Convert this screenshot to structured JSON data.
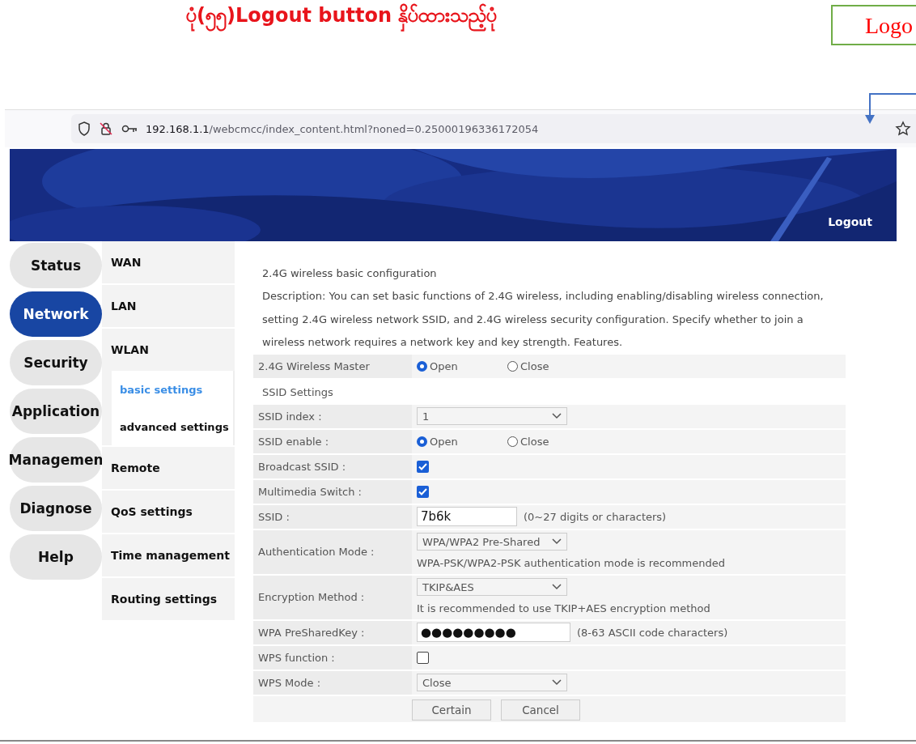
{
  "heading": "ပုံ(၅၅)Logout button နှိပ်ထားသည့်ပုံ",
  "callout": {
    "text": "Logo"
  },
  "browser": {
    "url_host": "192.168.1.1",
    "url_path": "/webcmcc/index_content.html?noned=0.25000196336172054"
  },
  "banner": {
    "logout": "Logout"
  },
  "main_menu": [
    {
      "label": "Status",
      "selected": false
    },
    {
      "label": "Network",
      "selected": true
    },
    {
      "label": "Security",
      "selected": false
    },
    {
      "label": "Application",
      "selected": false
    },
    {
      "label": "Managemen",
      "selected": false
    },
    {
      "label": "Diagnose",
      "selected": false
    },
    {
      "label": "Help",
      "selected": false
    }
  ],
  "sub_menu": [
    {
      "label": "WAN",
      "selected": false
    },
    {
      "label": "LAN",
      "selected": false
    },
    {
      "label": "WLAN",
      "selected": false,
      "children": [
        {
          "label": "basic settings",
          "selected": true
        },
        {
          "label": "advanced settings",
          "selected": false
        }
      ]
    },
    {
      "label": "Remote",
      "selected": false
    },
    {
      "label": "QoS settings",
      "selected": false
    },
    {
      "label": "Time management",
      "selected": false
    },
    {
      "label": "Routing settings",
      "selected": false
    }
  ],
  "content": {
    "title": "2.4G wireless basic configuration",
    "description": "Description: You can set basic functions of 2.4G wireless, including enabling/disabling wireless connection, setting 2.4G wireless network SSID, and 2.4G wireless security configuration. Specify whether to join a wireless network requires a network key and key strength. Features.",
    "rows": [
      {
        "kind": "radio",
        "label": "2.4G Wireless Master",
        "options": [
          {
            "label": "Open",
            "selected": true
          },
          {
            "label": "Close",
            "selected": false
          }
        ]
      },
      {
        "kind": "section",
        "label": "SSID Settings"
      },
      {
        "kind": "select",
        "label": "SSID index :",
        "value": "1"
      },
      {
        "kind": "radio",
        "label": "SSID enable :",
        "options": [
          {
            "label": "Open",
            "selected": true
          },
          {
            "label": "Close",
            "selected": false
          }
        ]
      },
      {
        "kind": "checkbox",
        "label": "Broadcast SSID :",
        "checked": true
      },
      {
        "kind": "checkbox",
        "label": "Multimedia Switch :",
        "checked": true
      },
      {
        "kind": "text",
        "label": "SSID :",
        "value": "7b6k",
        "note": "(0~27 digits or characters)"
      },
      {
        "kind": "select",
        "label": "Authentication Mode :",
        "value": "WPA/WPA2 Pre-Shared",
        "hint": "WPA-PSK/WPA2-PSK authentication mode is recommended"
      },
      {
        "kind": "select",
        "label": "Encryption Method :",
        "value": "TKIP&AES",
        "hint": "It is recommended to use TKIP+AES encryption method"
      },
      {
        "kind": "password",
        "label": "WPA PreSharedKey :",
        "value": "●●●●●●●●●",
        "note": "(8-63 ASCII code characters)"
      },
      {
        "kind": "checkbox",
        "label": "WPS function :",
        "checked": false
      },
      {
        "kind": "select",
        "label": "WPS Mode :",
        "value": "Close"
      }
    ],
    "buttons": [
      "Certain",
      "Cancel"
    ]
  }
}
